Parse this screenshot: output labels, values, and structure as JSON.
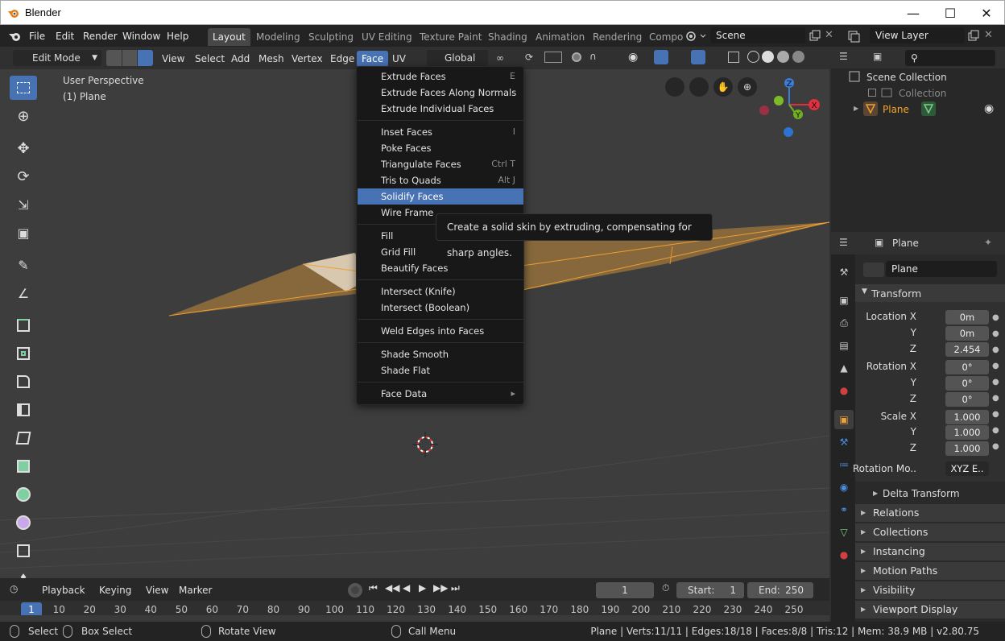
{
  "window": {
    "title": "Blender"
  },
  "topbar": {
    "menus": [
      "File",
      "Edit",
      "Render",
      "Window",
      "Help"
    ],
    "workspaces": [
      "Layout",
      "Modeling",
      "Sculpting",
      "UV Editing",
      "Texture Paint",
      "Shading",
      "Animation",
      "Rendering",
      "Compo"
    ],
    "active_workspace": "Layout",
    "scene": "Scene",
    "view_layer": "View Layer"
  },
  "viewport_header": {
    "mode": "Edit Mode",
    "menus": [
      "View",
      "Select",
      "Add",
      "Mesh",
      "Vertex",
      "Edge",
      "Face",
      "UV"
    ],
    "active_menu": "Face",
    "transform_orientation": "Global"
  },
  "viewport": {
    "perspective": "User Perspective",
    "object": "(1) Plane",
    "gizmo_axes": [
      "Z",
      "X",
      "Y"
    ]
  },
  "face_menu": {
    "groups": [
      [
        {
          "label": "Extrude Faces",
          "shortcut": "E"
        },
        {
          "label": "Extrude Faces Along Normals",
          "shortcut": ""
        },
        {
          "label": "Extrude Individual Faces",
          "shortcut": ""
        }
      ],
      [
        {
          "label": "Inset Faces",
          "shortcut": "I"
        },
        {
          "label": "Poke Faces",
          "shortcut": ""
        },
        {
          "label": "Triangulate Faces",
          "shortcut": "Ctrl T"
        },
        {
          "label": "Tris to Quads",
          "shortcut": "Alt J"
        },
        {
          "label": "Solidify Faces",
          "shortcut": "",
          "highlighted": true
        },
        {
          "label": "Wire Frame",
          "shortcut": ""
        }
      ],
      [
        {
          "label": "Fill",
          "shortcut": ""
        },
        {
          "label": "Grid Fill",
          "shortcut": ""
        },
        {
          "label": "Beautify Faces",
          "shortcut": ""
        }
      ],
      [
        {
          "label": "Intersect (Knife)",
          "shortcut": ""
        },
        {
          "label": "Intersect (Boolean)",
          "shortcut": ""
        }
      ],
      [
        {
          "label": "Weld Edges into Faces",
          "shortcut": ""
        }
      ],
      [
        {
          "label": "Shade Smooth",
          "shortcut": ""
        },
        {
          "label": "Shade Flat",
          "shortcut": ""
        }
      ],
      [
        {
          "label": "Face Data",
          "shortcut": "▸"
        }
      ]
    ]
  },
  "tooltip": "Create a solid skin by extruding, compensating for sharp angles.",
  "outliner": {
    "scene_collection": "Scene Collection",
    "collection": "Collection",
    "object": "Plane"
  },
  "properties": {
    "header_object": "Plane",
    "name_field": "Plane",
    "transform_label": "Transform",
    "location": {
      "label": "Location X",
      "x": "0m",
      "y": "0m",
      "z": "2.454"
    },
    "rotation": {
      "label": "Rotation X",
      "x": "0°",
      "y": "0°",
      "z": "0°"
    },
    "scale": {
      "label": "Scale X",
      "x": "1.000",
      "y": "1.000",
      "z": "1.000"
    },
    "axis_y": "Y",
    "axis_z": "Z",
    "rotation_mode_label": "Rotation Mo..",
    "rotation_mode": "XYZ E..",
    "delta_transform": "Delta Transform",
    "panels": [
      "Relations",
      "Collections",
      "Instancing",
      "Motion Paths",
      "Visibility",
      "Viewport Display"
    ]
  },
  "timeline": {
    "menus": [
      "Playback",
      "Keying",
      "View",
      "Marker"
    ],
    "current_frame": "1",
    "start_label": "Start:",
    "start": "1",
    "end_label": "End:",
    "end": "250",
    "ruler": [
      "1",
      "10",
      "20",
      "30",
      "40",
      "50",
      "60",
      "70",
      "80",
      "90",
      "100",
      "110",
      "120",
      "130",
      "140",
      "150",
      "160",
      "170",
      "180",
      "190",
      "200",
      "210",
      "220",
      "230",
      "240",
      "250"
    ]
  },
  "statusbar": {
    "select": "Select",
    "box_select": "Box Select",
    "rotate_view": "Rotate View",
    "call_menu": "Call Menu",
    "stats": "Plane | Verts:11/11 | Edges:18/18 | Faces:8/8 | Tris:12 | Mem: 38.9 MB | v2.80.75"
  },
  "colors": {
    "accent": "#4772b3",
    "selection_orange": "#e08a1f",
    "background": "#303030"
  }
}
